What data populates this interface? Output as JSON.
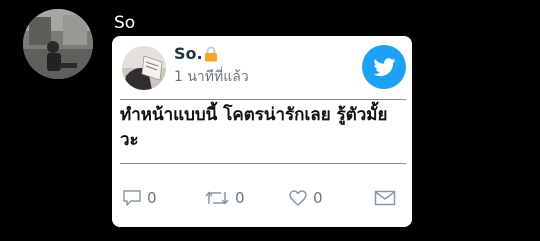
{
  "sender": {
    "name": "So"
  },
  "card": {
    "author_name": "So.",
    "timestamp": "1 นาทีที่แล้ว",
    "tweet_text": "ทำหน้าแบบนี้ โคตรน่ารักเลย รู้ตัวมั้ยวะ",
    "actions": {
      "reply_count": "0",
      "retweet_count": "0",
      "like_count": "0"
    }
  },
  "colors": {
    "background": "#000000",
    "card": "#ffffff",
    "twitter_blue": "#1da1f2",
    "lock": "#f5a623",
    "secondary_text": "#657786"
  },
  "icons": {
    "lock": "lock-icon",
    "twitter": "twitter-bird-icon",
    "reply": "reply-icon",
    "retweet": "retweet-icon",
    "like": "heart-icon",
    "mail": "mail-icon"
  }
}
